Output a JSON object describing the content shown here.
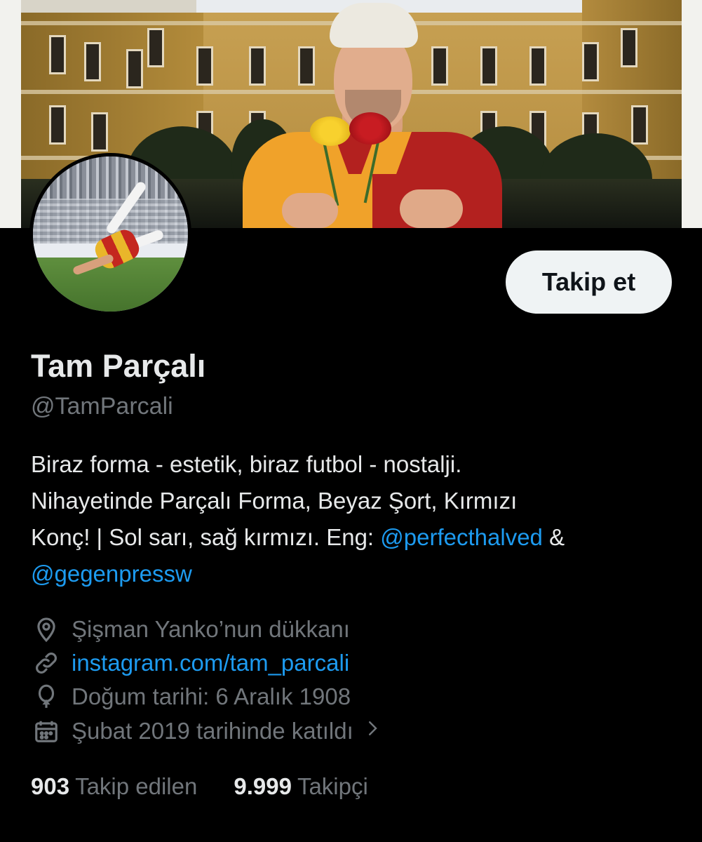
{
  "profile": {
    "name": "Tam Parçalı",
    "handle": "@TamParcali",
    "follow_label": "Takip et",
    "bio": {
      "line1": "Biraz forma - estetik, biraz futbol - nostalji.",
      "line2": "Nihayetinde Parçalı Forma, Beyaz Şort, Kırmızı",
      "line3_prefix": "Konç! | Sol sarı, sağ kırmızı. Eng: ",
      "mention1": "@perfecthalved",
      "line3_suffix": " &",
      "mention2": "@gegenpressw"
    },
    "location": "Şişman Yanko’nun dükkanı",
    "website": "instagram.com/tam_parcali",
    "birth_date": "Doğum tarihi: 6 Aralık 1908",
    "joined": "Şubat 2019 tarihinde katıldı",
    "following_count": "903",
    "following_label": "Takip edilen",
    "followers_count": "9.999",
    "followers_label": "Takipçi"
  },
  "icons": {
    "location": "location-pin-icon",
    "link": "link-icon",
    "birthday": "balloon-icon",
    "calendar": "calendar-icon",
    "chevron": "chevron-right-icon"
  },
  "colors": {
    "background": "#000000",
    "text_primary": "#e7e9ea",
    "text_secondary": "#71767b",
    "link": "#1d9bf0",
    "button_bg": "#eff3f4"
  }
}
